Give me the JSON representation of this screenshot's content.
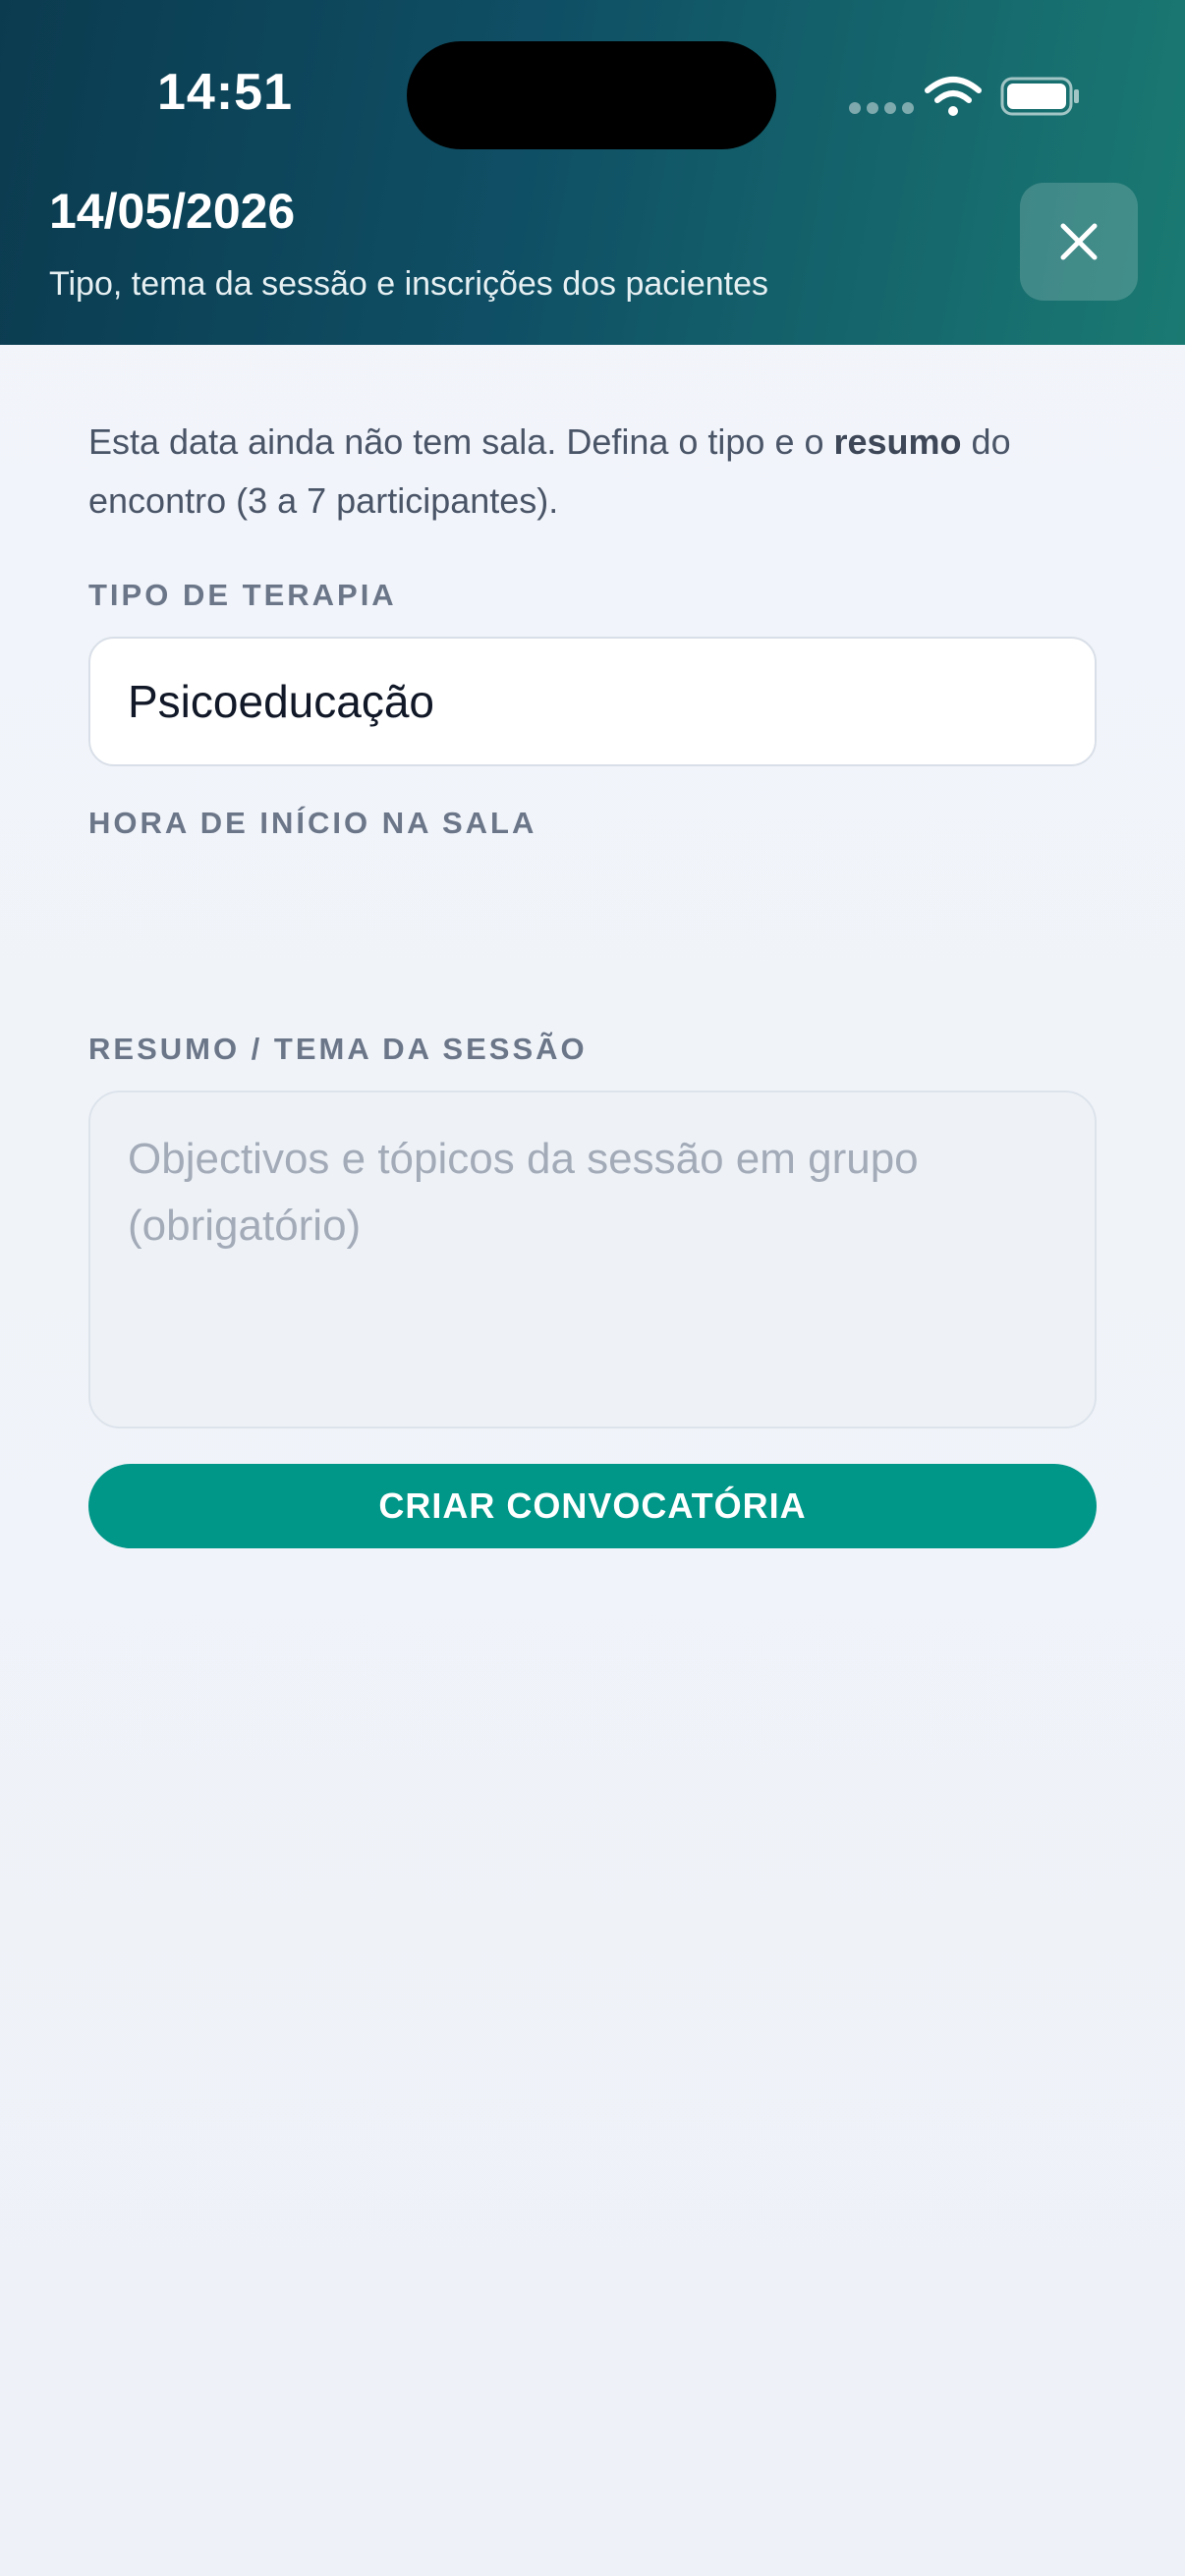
{
  "status_bar": {
    "time": "14:51",
    "icons": [
      "signal-dots-icon",
      "wifi-icon",
      "battery-icon"
    ]
  },
  "header": {
    "title": "14/05/2026",
    "subtitle": "Tipo, tema da sessão e inscrições dos pacientes",
    "close_icon": "close-icon"
  },
  "intro": {
    "text_before": "Esta data ainda não tem sala. Defina o tipo e o ",
    "text_bold": "resumo",
    "text_after": " do encontro (3 a 7 participantes)."
  },
  "form": {
    "therapy_type_label": "TIPO DE TERAPIA",
    "therapy_type_value": "Psicoeducação",
    "start_hour_label": "HORA DE INÍCIO NA SALA",
    "summary_label": "RESUMO / TEMA DA SESSÃO",
    "summary_placeholder": "Objectivos e tópicos da sessão em grupo (obrigatório)",
    "summary_value": ""
  },
  "actions": {
    "create_label": "CRIAR CONVOCATÓRIA"
  },
  "colors": {
    "header_gradient_start": "#0b3b4f",
    "header_gradient_end": "#1a7a72",
    "primary": "#009688",
    "label": "#6b7689",
    "body_text": "#4a5568"
  }
}
